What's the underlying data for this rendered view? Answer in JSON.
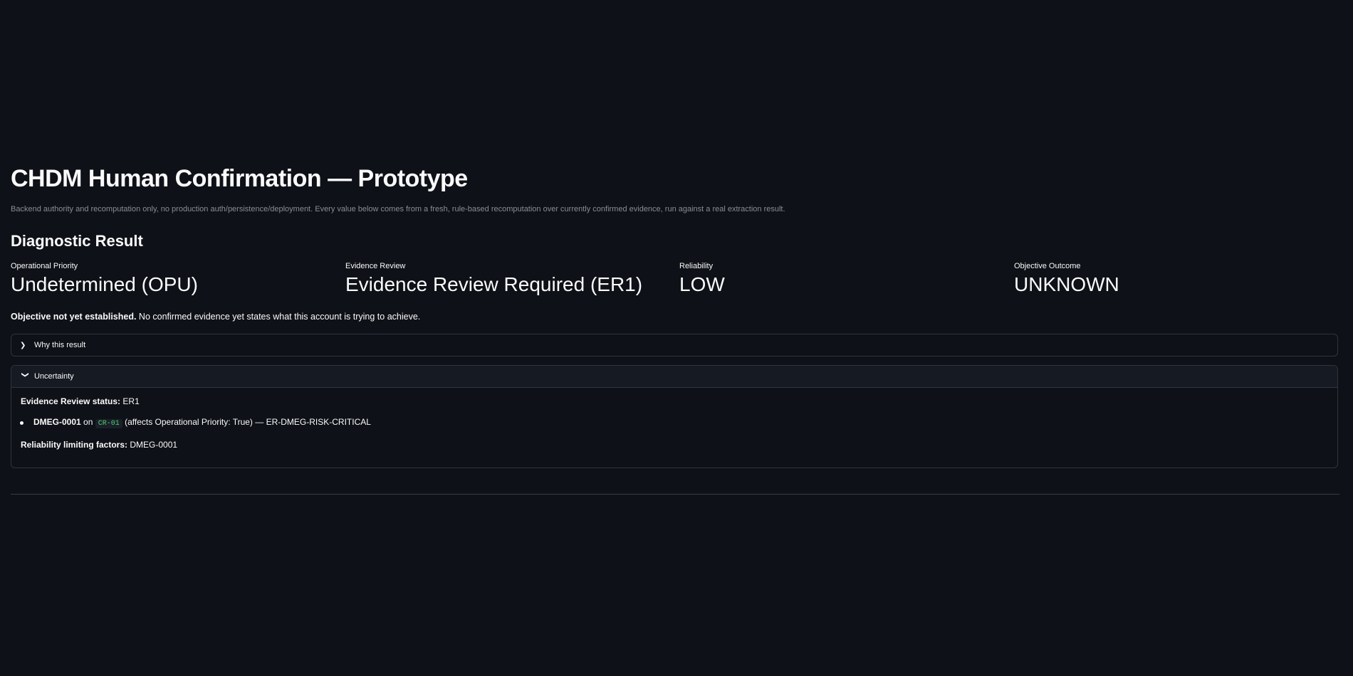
{
  "page": {
    "title": "CHDM Human Confirmation — Prototype",
    "caption": "Backend authority and recomputation only, no production auth/persistence/deployment. Every value below comes from a fresh, rule-based recomputation over currently confirmed evidence, run against a real extraction result."
  },
  "diagnostic": {
    "header": "Diagnostic Result",
    "metrics": [
      {
        "label": "Operational Priority",
        "value": "Undetermined (OPU)"
      },
      {
        "label": "Evidence Review",
        "value": "Evidence Review Required (ER1)"
      },
      {
        "label": "Reliability",
        "value": "LOW"
      },
      {
        "label": "Objective Outcome",
        "value": "UNKNOWN"
      }
    ],
    "objective_note_bold": "Objective not yet established.",
    "objective_note_text": " No confirmed evidence yet states what this account is trying to achieve."
  },
  "expanders": {
    "why": {
      "label": "Why this result",
      "expanded": false,
      "icon": "chevron-right-icon"
    },
    "uncertainty": {
      "label": "Uncertainty",
      "expanded": true,
      "icon": "chevron-down-icon",
      "status_label": "Evidence Review status:",
      "status_value": " ER1",
      "items": [
        {
          "id": "DMEG-0001",
          "on": " on ",
          "code": "CR-01",
          "detail": " (affects Operational Priority: True) — ER-DMEG-RISK-CRITICAL"
        }
      ],
      "limiting_label": "Reliability limiting factors:",
      "limiting_value": " DMEG-0001"
    }
  },
  "colors": {
    "background": "#0e1117",
    "text": "#fafafa",
    "caption": "#8b8d95",
    "border": "#31333f",
    "code_text": "#4fd16a"
  }
}
